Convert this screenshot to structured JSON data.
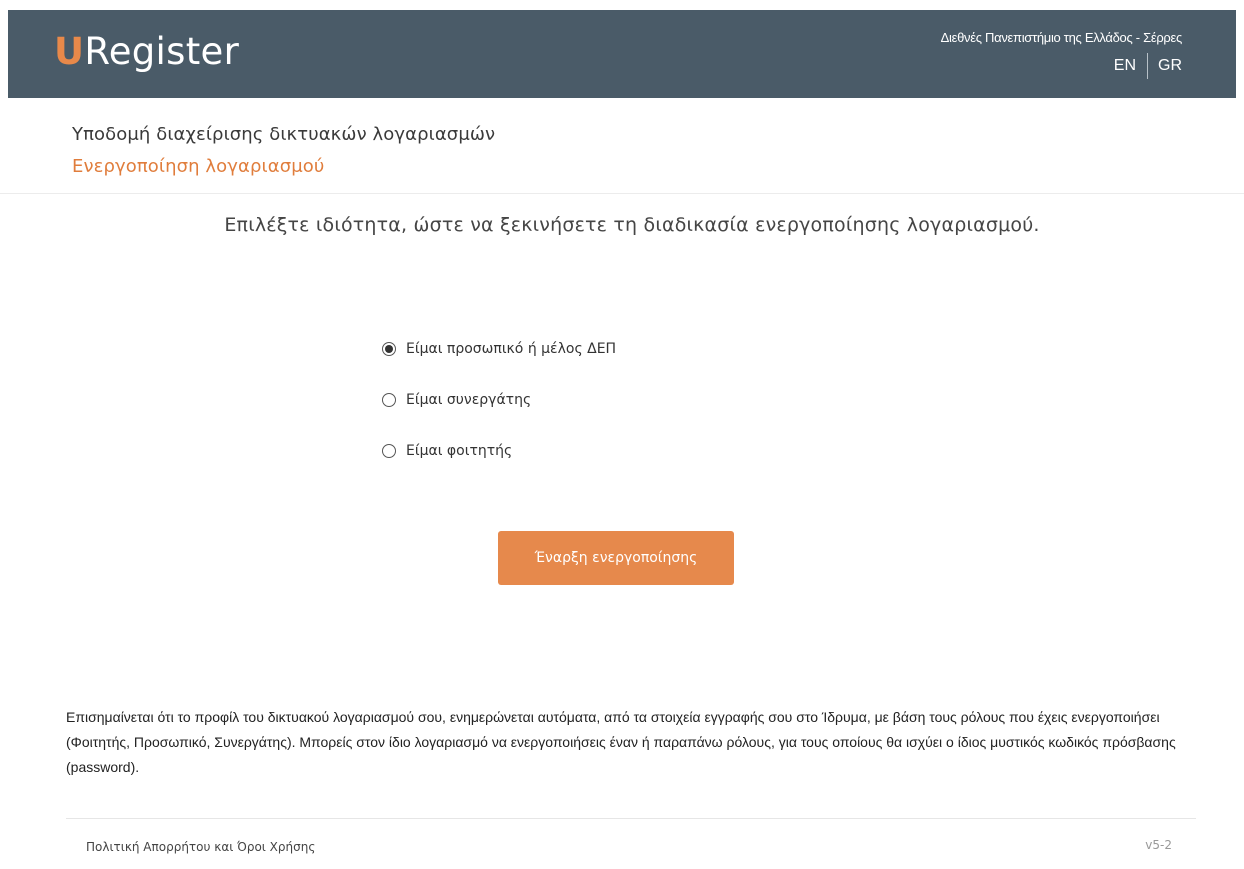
{
  "header": {
    "logo_u": "U",
    "logo_rest": "Register",
    "institution": "Διεθνές Πανεπιστήμιο της Ελλάδος - Σέρρες",
    "languages": [
      "EN",
      "GR"
    ]
  },
  "page": {
    "title": "Υποδομή διαχείρισης δικτυακών λογαριασμών",
    "subtitle": "Ενεργοποίηση λογαριασμού",
    "instruction": "Επιλέξτε ιδιότητα, ώστε να ξεκινήσετε τη διαδικασία ενεργοποίησης λογαριασμού."
  },
  "role_options": [
    {
      "label": "Είμαι προσωπικό ή μέλος ΔΕΠ",
      "selected": true
    },
    {
      "label": "Είμαι συνεργάτης",
      "selected": false
    },
    {
      "label": "Είμαι φοιτητής",
      "selected": false
    }
  ],
  "actions": {
    "start_label": "Έναρξη ενεργοποίησης"
  },
  "notice": {
    "text": "Επισημαίνεται ότι το προφίλ του δικτυακού λογαριασμού σου, ενημερώνεται αυτόματα, από τα στοιχεία εγγραφής σου στο Ίδρυμα, με βάση τους ρόλους που έχεις ενεργοποιήσει (Φοιτητής, Προσωπικό, Συνεργάτης). Μπορείς στον ίδιο λογαριασμό να ενεργοποιήσεις έναν ή παραπάνω ρόλους, για τους οποίους θα ισχύει ο ίδιος μυστικός κωδικός πρόσβασης (password)."
  },
  "footer": {
    "privacy_link": "Πολιτική Απορρήτου και Όροι Χρήσης",
    "version": "v5-2"
  },
  "colors": {
    "header_bg": "#4a5b68",
    "accent": "#e6894c"
  }
}
